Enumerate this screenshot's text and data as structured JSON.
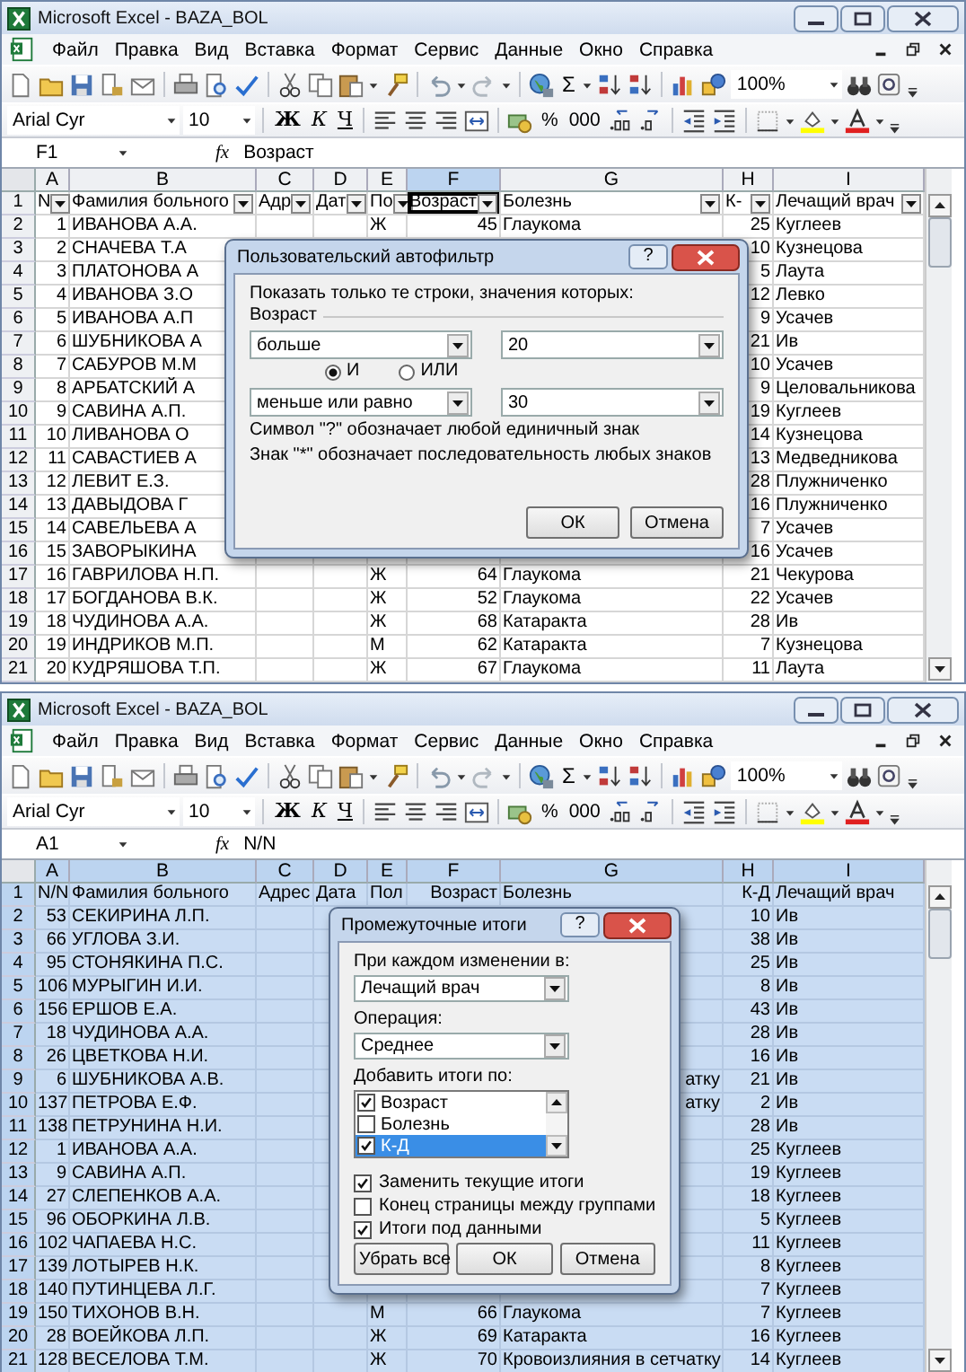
{
  "windows": [
    {
      "title": "Microsoft Excel - BAZA_BOL",
      "menu": [
        "Файл",
        "Правка",
        "Вид",
        "Вставка",
        "Формат",
        "Сервис",
        "Данные",
        "Окно",
        "Справка"
      ],
      "toolbar": {
        "sum": "Σ",
        "zoom": "100%"
      },
      "format_bar": {
        "font": "Arial Cyr",
        "size": "10",
        "styles": [
          "Ж",
          "К",
          "Ч"
        ],
        "number": [
          "%",
          "000"
        ]
      },
      "formula_bar": {
        "cell": "F1",
        "fx": "fx",
        "value": "Возраст"
      },
      "sheet": {
        "autofilter": true,
        "rows_selected": false,
        "columns": [
          {
            "label": "A",
            "selected": false
          },
          {
            "label": "B",
            "selected": false
          },
          {
            "label": "C",
            "selected": false
          },
          {
            "label": "D",
            "selected": false
          },
          {
            "label": "E",
            "selected": false
          },
          {
            "label": "F",
            "selected": true
          },
          {
            "label": "G",
            "selected": false
          },
          {
            "label": "H",
            "selected": false
          },
          {
            "label": "I",
            "selected": false
          }
        ],
        "header": {
          "row": "1",
          "n": "N",
          "name": "Фамилия больного",
          "address": "Адр",
          "date": "Дат",
          "sex": "По",
          "age": "Возраст",
          "disease": "Болезнь",
          "kd": "К-",
          "doctor": "Лечащий врач"
        },
        "rows": [
          {
            "row": "2",
            "n": "1",
            "name": "ИВАНОВА А.А.",
            "sex": "Ж",
            "age": "45",
            "disease": "Глаукома",
            "kd": "25",
            "doctor": "Куглеев"
          },
          {
            "row": "3",
            "n": "2",
            "name": "СНАЧЕВА Т.А",
            "kd": "10",
            "doctor": "Кузнецова"
          },
          {
            "row": "4",
            "n": "3",
            "name": "ПЛАТОНОВА А",
            "kd": "5",
            "doctor": "Лаута"
          },
          {
            "row": "5",
            "n": "4",
            "name": "ИВАНОВА З.О",
            "kd": "12",
            "doctor": "Левко"
          },
          {
            "row": "6",
            "n": "5",
            "name": "ИВАНОВА А.П",
            "kd": "9",
            "doctor": "Усачев"
          },
          {
            "row": "7",
            "n": "6",
            "name": "ШУБНИКОВА А",
            "kd": "21",
            "doctor": "Ив"
          },
          {
            "row": "8",
            "n": "7",
            "name": "САБУРОВ М.М",
            "kd": "10",
            "doctor": "Усачев"
          },
          {
            "row": "9",
            "n": "8",
            "name": "АРБАТСКИЙ А",
            "kd": "9",
            "doctor": "Целовальникова"
          },
          {
            "row": "10",
            "n": "9",
            "name": "САВИНА А.П.",
            "kd": "19",
            "doctor": "Куглеев"
          },
          {
            "row": "11",
            "n": "10",
            "name": "ЛИВАНОВА О",
            "kd": "14",
            "doctor": "Кузнецова"
          },
          {
            "row": "12",
            "n": "11",
            "name": "САВАСТИЕВ А",
            "kd": "13",
            "doctor": "Медведникова"
          },
          {
            "row": "13",
            "n": "12",
            "name": "ЛЕВИТ Е.З.",
            "kd": "28",
            "doctor": "Плужниченко"
          },
          {
            "row": "14",
            "n": "13",
            "name": "ДАВЫДОВА Г",
            "kd": "16",
            "doctor": "Плужниченко"
          },
          {
            "row": "15",
            "n": "14",
            "name": "САВЕЛЬЕВА А",
            "kd": "7",
            "doctor": "Усачев"
          },
          {
            "row": "16",
            "n": "15",
            "name": "ЗАВОРЫКИНА",
            "kd": "16",
            "doctor": "Усачев"
          },
          {
            "row": "17",
            "n": "16",
            "name": "ГАВРИЛОВА Н.П.",
            "sex": "Ж",
            "age": "64",
            "disease": "Глаукома",
            "kd": "21",
            "doctor": "Чекурова"
          },
          {
            "row": "18",
            "n": "17",
            "name": "БОГДАНОВА В.К.",
            "sex": "Ж",
            "age": "52",
            "disease": "Глаукома",
            "kd": "22",
            "doctor": "Усачев"
          },
          {
            "row": "19",
            "n": "18",
            "name": "ЧУДИНОВА А.А.",
            "sex": "Ж",
            "age": "68",
            "disease": "Катаракта",
            "kd": "28",
            "doctor": "Ив"
          },
          {
            "row": "20",
            "n": "19",
            "name": "ИНДРИКОВ М.П.",
            "sex": "М",
            "age": "62",
            "disease": "Катаракта",
            "kd": "7",
            "doctor": "Кузнецова"
          },
          {
            "row": "21",
            "n": "20",
            "name": "КУДРЯШОВА Т.П.",
            "sex": "Ж",
            "age": "67",
            "disease": "Глаукома",
            "kd": "11",
            "doctor": "Лаута"
          }
        ]
      },
      "dialog": {
        "kind": "autofilter",
        "title": "Пользовательский автофильтр",
        "help": "?",
        "prompt": "Показать только те строки, значения которых:",
        "field": "Возраст",
        "conditions": [
          {
            "operator": "больше",
            "value": "20"
          },
          {
            "operator": "меньше или равно",
            "value": "30"
          }
        ],
        "joins": [
          {
            "label": "И",
            "selected": true
          },
          {
            "label": "ИЛИ",
            "selected": false
          }
        ],
        "notes": [
          "Символ \"?\" обозначает любой единичный знак",
          "Знак \"*\" обозначает последовательность любых знаков"
        ],
        "buttons": [
          "ОК",
          "Отмена"
        ]
      }
    },
    {
      "title": "Microsoft Excel - BAZA_BOL",
      "menu": [
        "Файл",
        "Правка",
        "Вид",
        "Вставка",
        "Формат",
        "Сервис",
        "Данные",
        "Окно",
        "Справка"
      ],
      "toolbar": {
        "sum": "Σ",
        "zoom": "100%"
      },
      "format_bar": {
        "font": "Arial Cyr",
        "size": "10",
        "styles": [
          "Ж",
          "К",
          "Ч"
        ],
        "number": [
          "%",
          "000"
        ]
      },
      "formula_bar": {
        "cell": "A1",
        "fx": "fx",
        "value": "N/N"
      },
      "sheet": {
        "autofilter": false,
        "rows_selected": true,
        "columns": [
          {
            "label": "A",
            "selected": true
          },
          {
            "label": "B",
            "selected": true
          },
          {
            "label": "C",
            "selected": true
          },
          {
            "label": "D",
            "selected": true
          },
          {
            "label": "E",
            "selected": true
          },
          {
            "label": "F",
            "selected": true
          },
          {
            "label": "G",
            "selected": true
          },
          {
            "label": "H",
            "selected": true
          },
          {
            "label": "I",
            "selected": true
          }
        ],
        "header": {
          "row": "1",
          "n": "N/N",
          "name": "Фамилия больного",
          "address": "Адрес",
          "date": "Дата",
          "sex": "Пол",
          "age": "Возраст",
          "disease": "Болезнь",
          "kd": "К-Д",
          "doctor": "Лечащий врач"
        },
        "rows": [
          {
            "row": "2",
            "n": "53",
            "name": "СЕКИРИНА Л.П.",
            "kd": "10",
            "doctor": "Ив"
          },
          {
            "row": "3",
            "n": "66",
            "name": "УГЛОВА З.И.",
            "kd": "38",
            "doctor": "Ив"
          },
          {
            "row": "4",
            "n": "95",
            "name": "СТОНЯКИНА П.С.",
            "kd": "25",
            "doctor": "Ив"
          },
          {
            "row": "5",
            "n": "106",
            "name": "МУРЫГИН И.И.",
            "kd": "8",
            "doctor": "Ив"
          },
          {
            "row": "6",
            "n": "156",
            "name": "ЕРШОВ Е.А.",
            "kd": "43",
            "doctor": "Ив"
          },
          {
            "row": "7",
            "n": "18",
            "name": "ЧУДИНОВА А.А.",
            "kd": "28",
            "doctor": "Ив"
          },
          {
            "row": "8",
            "n": "26",
            "name": "ЦВЕТКОВА Н.И.",
            "kd": "16",
            "doctor": "Ив"
          },
          {
            "row": "9",
            "n": "6",
            "name": "ШУБНИКОВА А.В.",
            "disease": "атку",
            "cut": true,
            "kd": "21",
            "doctor": "Ив"
          },
          {
            "row": "10",
            "n": "137",
            "name": "ПЕТРОВА Е.Ф.",
            "disease": "атку",
            "cut": true,
            "kd": "2",
            "doctor": "Ив"
          },
          {
            "row": "11",
            "n": "138",
            "name": "ПЕТРУНИНА Н.И.",
            "kd": "28",
            "doctor": "Ив"
          },
          {
            "row": "12",
            "n": "1",
            "name": "ИВАНОВА А.А.",
            "kd": "25",
            "doctor": "Куглеев"
          },
          {
            "row": "13",
            "n": "9",
            "name": "САВИНА А.П.",
            "kd": "19",
            "doctor": "Куглеев"
          },
          {
            "row": "14",
            "n": "27",
            "name": "СЛЕПЕНКОВ А.А.",
            "kd": "18",
            "doctor": "Куглеев"
          },
          {
            "row": "15",
            "n": "96",
            "name": "ОБОРКИНА Л.В.",
            "kd": "5",
            "doctor": "Куглеев"
          },
          {
            "row": "16",
            "n": "102",
            "name": "ЧАПАЕВА Н.С.",
            "kd": "11",
            "doctor": "Куглеев"
          },
          {
            "row": "17",
            "n": "139",
            "name": "ЛОТЫРЕВ Н.К.",
            "kd": "8",
            "doctor": "Куглеев"
          },
          {
            "row": "18",
            "n": "140",
            "name": "ПУТИНЦЕВА Л.Г.",
            "kd": "7",
            "doctor": "Куглеев"
          },
          {
            "row": "19",
            "n": "150",
            "name": "ТИХОНОВ В.Н.",
            "sex": "М",
            "age": "66",
            "disease": "Глаукома",
            "kd": "7",
            "doctor": "Куглеев"
          },
          {
            "row": "20",
            "n": "28",
            "name": "ВОЕЙКОВА Л.П.",
            "sex": "Ж",
            "age": "69",
            "disease": "Катаракта",
            "kd": "16",
            "doctor": "Куглеев"
          },
          {
            "row": "21",
            "n": "128",
            "name": "ВЕСЕЛОВА Т.М.",
            "sex": "Ж",
            "age": "70",
            "disease": "Кровоизлияния в сетчатку",
            "kd": "14",
            "doctor": "Куглеев"
          }
        ]
      },
      "dialog": {
        "kind": "subtotals",
        "title": "Промежуточные итоги",
        "help": "?",
        "group_label": "При каждом изменении в:",
        "group_by": "Лечащий врач",
        "operation_label": "Операция:",
        "operation": "Среднее",
        "add_label": "Добавить итоги по:",
        "fields": [
          {
            "label": "Возраст",
            "checked": true,
            "selected": false
          },
          {
            "label": "Болезнь",
            "checked": false,
            "selected": false
          },
          {
            "label": "К-Д",
            "checked": true,
            "selected": true
          }
        ],
        "options": [
          {
            "label": "Заменить текущие итоги",
            "checked": true
          },
          {
            "label": "Конец страницы между группами",
            "checked": false
          },
          {
            "label": "Итоги под данными",
            "checked": true
          }
        ],
        "buttons": [
          "Убрать все",
          "ОК",
          "Отмена"
        ]
      }
    }
  ]
}
